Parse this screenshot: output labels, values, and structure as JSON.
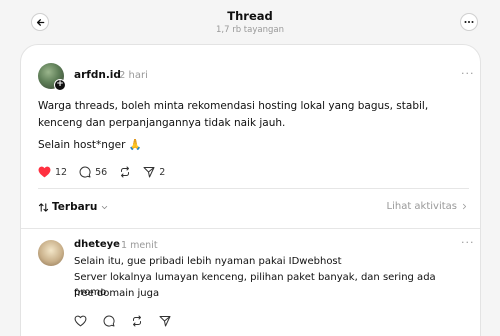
{
  "header": {
    "title": "Thread",
    "views": "1,7 rb tayangan",
    "back_icon": "arrow-left-icon",
    "more_icon": "more-horizontal-icon"
  },
  "post": {
    "username": "arfdn.id",
    "time": "2 hari",
    "more": "···",
    "text": "Warga threads, boleh minta rekomendasi hosting lokal yang bagus, stabil, kenceng dan perpanjangannya tidak naik jauh.",
    "text2": "Selain host*nger 🙏",
    "likes": "12",
    "comments": "56",
    "shares": "2",
    "like_color": "#ff3040"
  },
  "sort": {
    "label": "Terbaru",
    "activity": "Lihat aktivitas"
  },
  "reply": {
    "username": "dheteye",
    "time": "1 menit",
    "more": "···",
    "lines": [
      "Selain itu, gue pribadi lebih nyaman pakai IDwebhost",
      "Server lokalnya lumayan kenceng, pilihan paket banyak, dan sering ada promo",
      "free domain juga"
    ]
  }
}
